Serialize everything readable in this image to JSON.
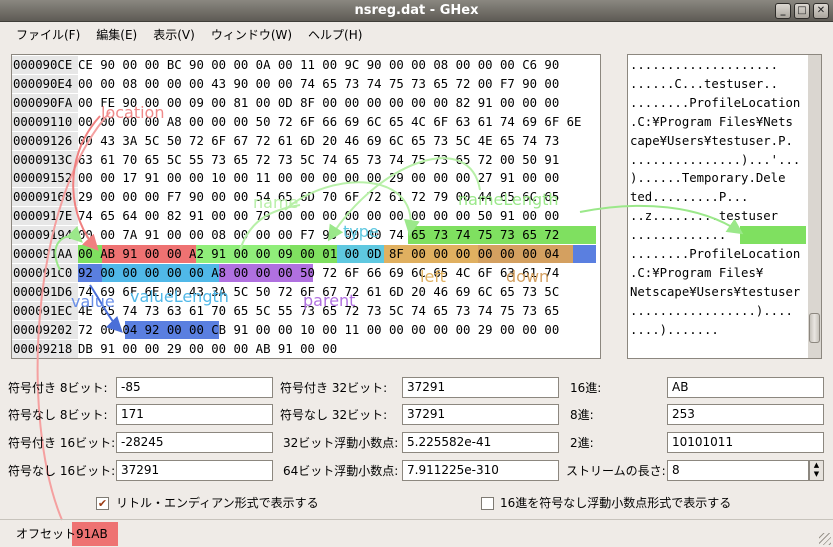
{
  "window": {
    "title": "nsreg.dat - GHex"
  },
  "menu": [
    "ファイル(F)",
    "編集(E)",
    "表示(V)",
    "ウィンドウ(W)",
    "ヘルプ(H)"
  ],
  "hex_rows": [
    {
      "offset": "000090CE",
      "hex": "CE 90 00 00 BC 90 00 00 0A 00 11 00 9C 90 00 00 08 00 00 00 C6 90",
      "ascii": "...................."
    },
    {
      "offset": "000090E4",
      "hex": "00 00 08 00 00 00 43 90 00 00 74 65 73 74 75 73 65 72 00 F7 90 00",
      "ascii": "......C...testuser.."
    },
    {
      "offset": "000090FA",
      "hex": "00 FE 90 00 00 09 00 81 00 0D 8F 00 00 00 00 00 00 82 91 00 00 00",
      "ascii": "........ProfileLocation"
    },
    {
      "offset": "00009110",
      "hex": "00 00 00 00 A8 00 00 00 50 72 6F 66 69 6C 65 4C 6F 63 61 74 69 6F 6E",
      "ascii": ".C:¥Program Files¥Nets"
    },
    {
      "offset": "00009126",
      "hex": "00 43 3A 5C 50 72 6F 67 72 61 6D 20 46 69 6C 65 73 5C 4E 65 74 73",
      "ascii": "cape¥Users¥testuser.P."
    },
    {
      "offset": "0000913C",
      "hex": "63 61 70 65 5C 55 73 65 72 73 5C 74 65 73 74 75 73 65 72 00 50 91",
      "ascii": "...............)...'..."
    },
    {
      "offset": "00009152",
      "hex": "00 00 17 91 00 00 10 00 11 00 00 00 00 00 29 00 00 00 27 91 00 00",
      "ascii": ")......Temporary.Dele"
    },
    {
      "offset": "00009168",
      "hex": "29 00 00 00 F7 90 00 00 54 65 6D 70 6F 72 61 72 79 00 44 65 6C 65",
      "ascii": "ted.........P..."
    },
    {
      "offset": "0000917E",
      "hex": "74 65 64 00 82 91 00 00 79 00 00 00 00 00 00 00 00 00 50 91 00 00",
      "ascii": "..z.........testuser"
    },
    {
      "offset": "00009194",
      "hex": "00 00 7A 91 00 00 08 00 00 00 F7 90 00 00 74 65 73 74 75 73 65 72",
      "ascii": "............."
    },
    {
      "offset": "000091AA",
      "hex": "00 AB 91 00 00 A2 91 00 00 09 00 01 00 0D 8F 00 00 00 00 00 00 04",
      "ascii": "........ProfileLocation"
    },
    {
      "offset": "000091C0",
      "hex": "92 00 00 00 00 00 A8 00 00 00 50 72 6F 66 69 6C 65 4C 6F 63 61 74",
      "ascii": ".C:¥Program Files¥"
    },
    {
      "offset": "000091D6",
      "hex": "74 69 6F 6E 00 43 3A 5C 50 72 6F 67 72 61 6D 20 46 69 6C 65 73 5C",
      "ascii": "Netscape¥Users¥testuser"
    },
    {
      "offset": "000091EC",
      "hex": "4E 65 74 73 63 61 70 65 5C 55 73 65 72 73 5C 74 65 73 74 75 73 65",
      "ascii": ".................)...."
    },
    {
      "offset": "00009202",
      "hex": "72 00 04 92 00 00 CB 91 00 00 10 00 11 00 00 00 00 00 29 00 00 00",
      "ascii": "....)......."
    },
    {
      "offset": "00009218",
      "hex": "DB 91 00 00 29 00 00 00 AB 91 00 00",
      "ascii": ""
    }
  ],
  "annotations": {
    "location": "location",
    "name": "name",
    "nameLength": "nameLength",
    "type": "type",
    "left": "left",
    "down": "down",
    "value": "value",
    "valueLength": "valueLength",
    "parent": "parent"
  },
  "colors": {
    "location": "#ee7272",
    "name": "#90ee7a",
    "nameLength": "#7fe060",
    "type": "#5fc8e0",
    "left": "#e0b060",
    "down": "#d4a060",
    "value": "#5a7fe0",
    "valueLength": "#50b8e8",
    "parent": "#b070e0"
  },
  "fields": {
    "s8_label": "符号付き 8ビット:",
    "s8_value": "-85",
    "u8_label": "符号なし 8ビット:",
    "u8_value": "171",
    "s16_label": "符号付き 16ビット:",
    "s16_value": "-28245",
    "u16_label": "符号なし 16ビット:",
    "u16_value": "37291",
    "s32_label": "符号付き 32ビット:",
    "s32_value": "37291",
    "u32_label": "符号なし 32ビット:",
    "u32_value": "37291",
    "f32_label": "32ビット浮動小数点:",
    "f32_value": "5.225582e-41",
    "f64_label": "64ビット浮動小数点:",
    "f64_value": "7.911225e-310",
    "hex_label": "16進:",
    "hex_value": "AB",
    "oct_label": "8進:",
    "oct_value": "253",
    "bin_label": "2進:",
    "bin_value": "10101011",
    "stream_label": "ストリームの長さ:",
    "stream_value": "8"
  },
  "options": {
    "little_endian": "リトル・エンディアン形式で表示する",
    "unsigned_hex": "16進を符号なし浮動小数点形式で表示する"
  },
  "status": {
    "label": "オフセット:",
    "value": "91AB"
  },
  "ascii_highlight": "testuser"
}
